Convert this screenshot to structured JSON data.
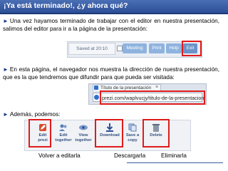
{
  "slide": {
    "title": "¡Ya está terminado!, ¿y ahora qué?",
    "bullet_glyph": "►",
    "paragraph1": "Una vez hayamos terminado de trabajar con el editor en nuestra presentación, salimos del editor para ir a la página de la presentación:",
    "paragraph2": "En esta página, el navegador nos muestra la dirección de nuestra presentación, que es la que tendremos que difundir para que pueda ser visitada:",
    "paragraph3": "Además, podemos:",
    "colors": {
      "header": "#2d4f97",
      "highlight": "#e01b1b",
      "accent": "#1f3d8a"
    }
  },
  "toolbar": {
    "saved": "Saved at 20:10",
    "meeting": "Meeting",
    "print": "Print",
    "help": "Help",
    "exit": "Exit"
  },
  "browser": {
    "tab_title": "Título de la presentación",
    "tab_close": "×",
    "url": "prezi.com/waplvucjy/titulo-de-la-presentacion/",
    "tab_icon": "prezi-icon",
    "url_icon": "globe-icon"
  },
  "actions": {
    "edit": "Edit prezi",
    "edit_together": "Edit together",
    "view_together": "View together",
    "download": "Download",
    "save_copy": "Save a copy",
    "delete": "Delete"
  },
  "captions": {
    "edit": "Volver a editarla",
    "download": "Descargarla",
    "delete": "Eliminarla"
  }
}
